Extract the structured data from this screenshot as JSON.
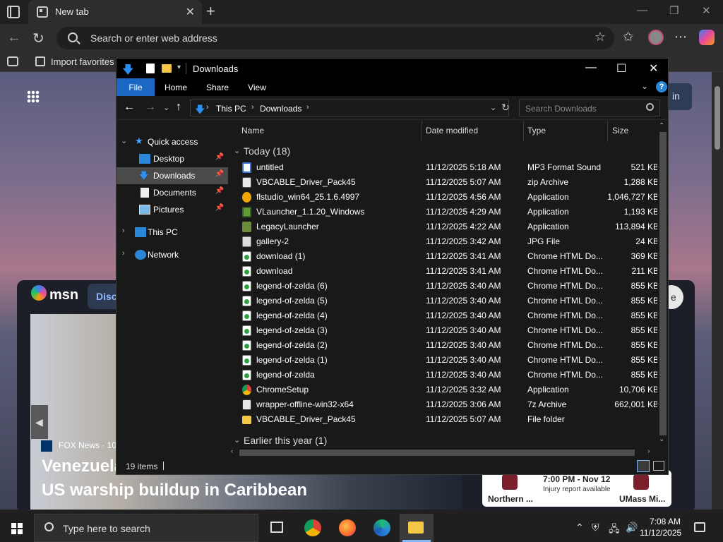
{
  "browser": {
    "tab_title": "New tab",
    "address_placeholder": "Search or enter web address",
    "favorites_import": "Import favorites"
  },
  "page": {
    "signin_label": "in",
    "msn_brand": "msn",
    "discover_label": "Disco",
    "news_source": "FOX News · 10",
    "news_headline_line1": "Venezuela",
    "news_headline_line2": "US warship buildup in Caribbean",
    "side_button_label": "e",
    "sports": {
      "time": "7:00 PM - Nov 12",
      "note": "Injury report available",
      "team_a": "Northern ...",
      "team_b": "UMass Mi..."
    }
  },
  "explorer": {
    "title": "Downloads",
    "ribbon_tabs": [
      "File",
      "Home",
      "Share",
      "View"
    ],
    "breadcrumb": [
      "This PC",
      "Downloads"
    ],
    "search_placeholder": "Search Downloads",
    "nav": {
      "quick_access": "Quick access",
      "items": [
        "Desktop",
        "Downloads",
        "Documents",
        "Pictures"
      ],
      "this_pc": "This PC",
      "network": "Network"
    },
    "columns": [
      "Name",
      "Date modified",
      "Type",
      "Size"
    ],
    "groups": {
      "today": "Today (18)",
      "earlier": "Earlier this year (1)"
    },
    "files": [
      {
        "name": "untitled",
        "date": "11/12/2025 5:18 AM",
        "type": "MP3 Format Sound",
        "size": "521 KB",
        "icon": "mp3-icon"
      },
      {
        "name": "VBCABLE_Driver_Pack45",
        "date": "11/12/2025 5:07 AM",
        "type": "zip Archive",
        "size": "1,288 KB",
        "icon": "zip-icon"
      },
      {
        "name": "flstudio_win64_25.1.6.4997",
        "date": "11/12/2025 4:56 AM",
        "type": "Application",
        "size": "1,046,727 KB",
        "icon": "flstudio-icon"
      },
      {
        "name": "VLauncher_1.1.20_Windows",
        "date": "11/12/2025 4:29 AM",
        "type": "Application",
        "size": "1,193 KB",
        "icon": "minecraft-icon"
      },
      {
        "name": "LegacyLauncher",
        "date": "11/12/2025 4:22 AM",
        "type": "Application",
        "size": "113,894 KB",
        "icon": "launcher-icon"
      },
      {
        "name": "gallery-2",
        "date": "11/12/2025 3:42 AM",
        "type": "JPG File",
        "size": "24 KB",
        "icon": "jpg-icon"
      },
      {
        "name": "download (1)",
        "date": "11/12/2025 3:41 AM",
        "type": "Chrome HTML Do...",
        "size": "369 KB",
        "icon": "html-icon"
      },
      {
        "name": "download",
        "date": "11/12/2025 3:41 AM",
        "type": "Chrome HTML Do...",
        "size": "211 KB",
        "icon": "html-icon"
      },
      {
        "name": "legend-of-zelda (6)",
        "date": "11/12/2025 3:40 AM",
        "type": "Chrome HTML Do...",
        "size": "855 KB",
        "icon": "html-icon"
      },
      {
        "name": "legend-of-zelda (5)",
        "date": "11/12/2025 3:40 AM",
        "type": "Chrome HTML Do...",
        "size": "855 KB",
        "icon": "html-icon"
      },
      {
        "name": "legend-of-zelda (4)",
        "date": "11/12/2025 3:40 AM",
        "type": "Chrome HTML Do...",
        "size": "855 KB",
        "icon": "html-icon"
      },
      {
        "name": "legend-of-zelda (3)",
        "date": "11/12/2025 3:40 AM",
        "type": "Chrome HTML Do...",
        "size": "855 KB",
        "icon": "html-icon"
      },
      {
        "name": "legend-of-zelda (2)",
        "date": "11/12/2025 3:40 AM",
        "type": "Chrome HTML Do...",
        "size": "855 KB",
        "icon": "html-icon"
      },
      {
        "name": "legend-of-zelda (1)",
        "date": "11/12/2025 3:40 AM",
        "type": "Chrome HTML Do...",
        "size": "855 KB",
        "icon": "html-icon"
      },
      {
        "name": "legend-of-zelda",
        "date": "11/12/2025 3:40 AM",
        "type": "Chrome HTML Do...",
        "size": "855 KB",
        "icon": "html-icon"
      },
      {
        "name": "ChromeSetup",
        "date": "11/12/2025 3:32 AM",
        "type": "Application",
        "size": "10,706 KB",
        "icon": "chrome-setup-icon"
      },
      {
        "name": "wrapper-offline-win32-x64",
        "date": "11/12/2025 3:06 AM",
        "type": "7z Archive",
        "size": "662,001 KB",
        "icon": "7z-icon"
      },
      {
        "name": "VBCABLE_Driver_Pack45",
        "date": "11/12/2025 5:07 AM",
        "type": "File folder",
        "size": "",
        "icon": "folder-icon"
      }
    ],
    "status_count": "19 items"
  },
  "taskbar": {
    "search_placeholder": "Type here to search",
    "time": "7:08 AM",
    "date": "11/12/2025"
  },
  "colors": {
    "accent": "#1a67c4",
    "explorer_bg": "#191919",
    "selection": "#4a4a4a"
  }
}
